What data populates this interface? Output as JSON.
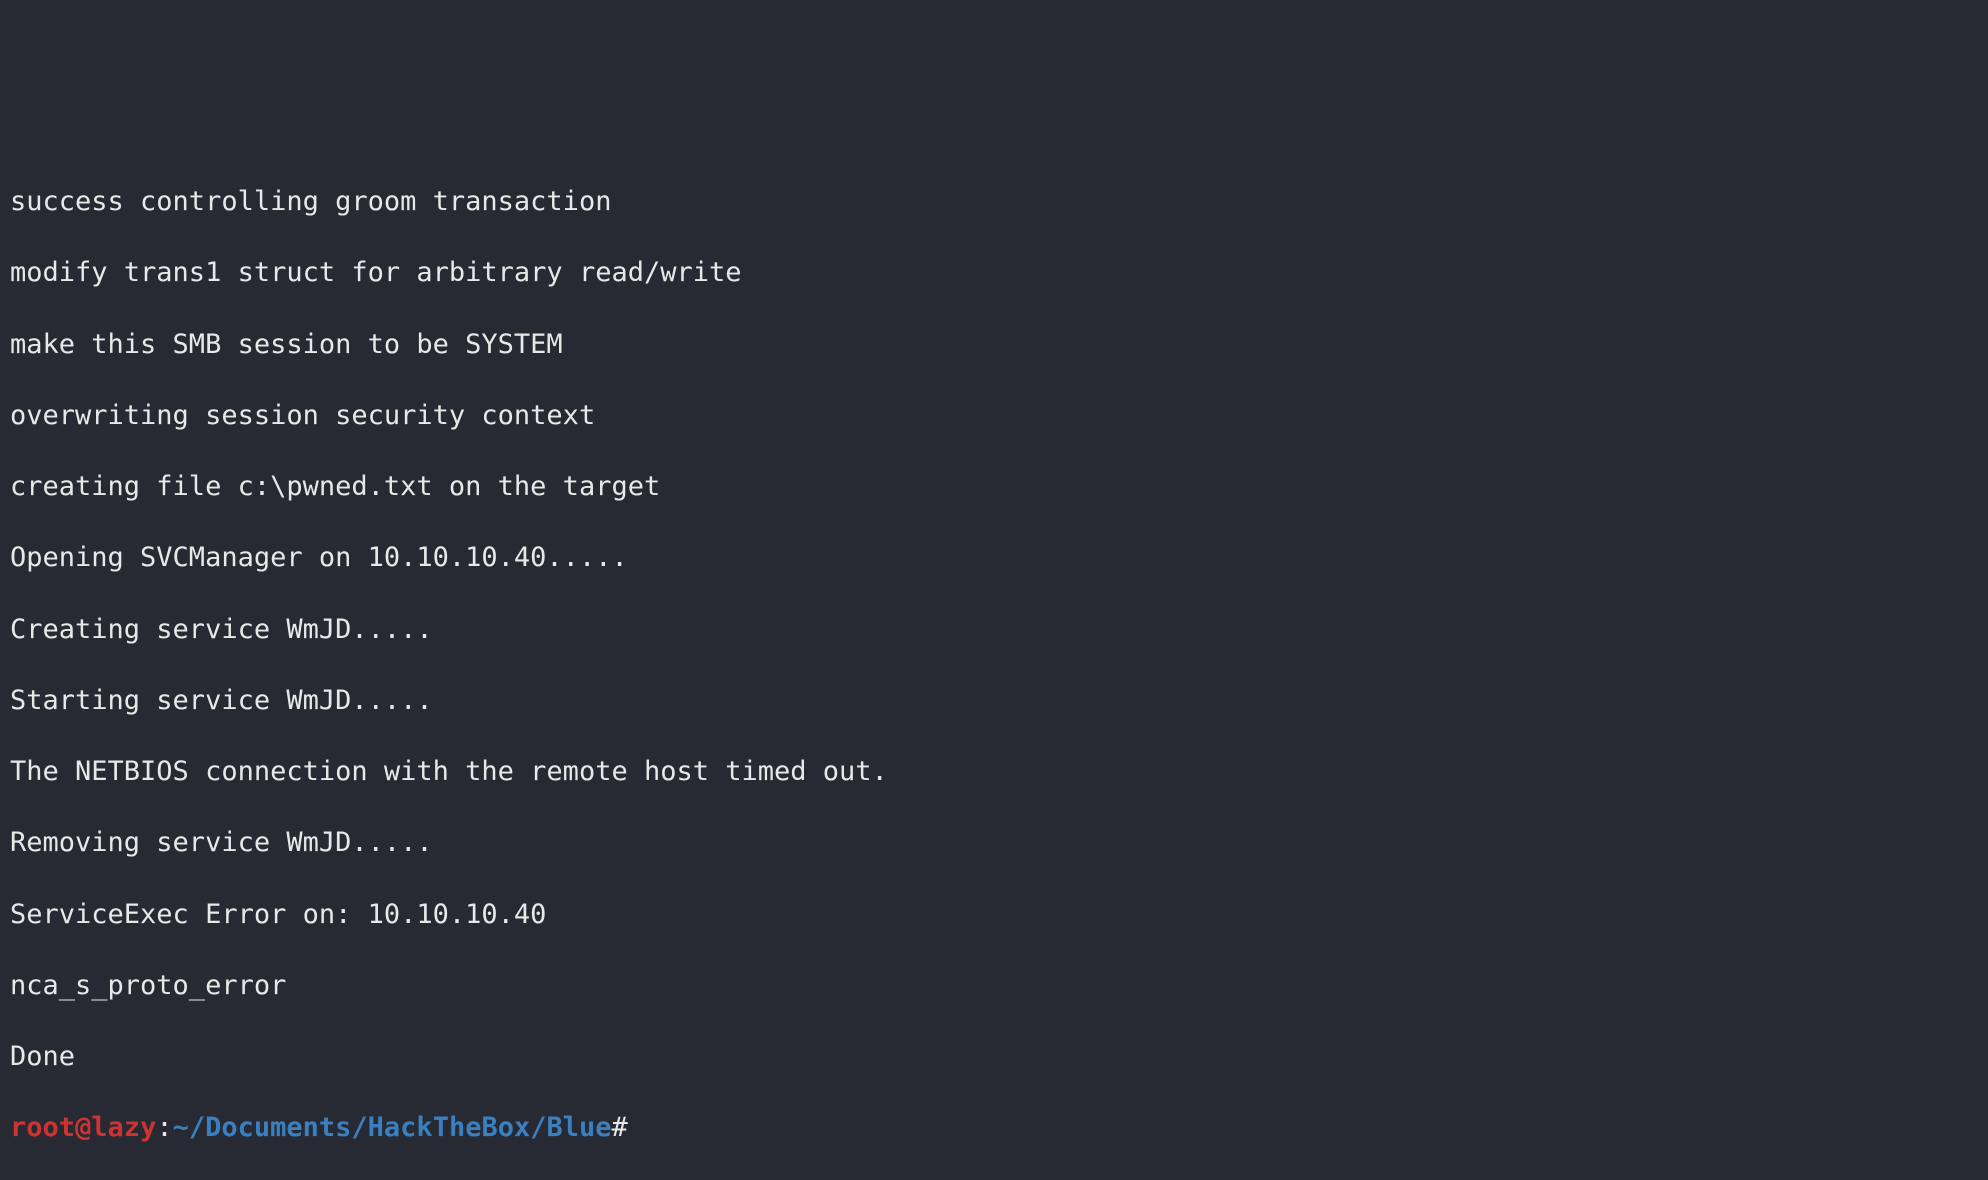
{
  "output": {
    "lines": [
      "success controlling groom transaction",
      "modify trans1 struct for arbitrary read/write",
      "make this SMB session to be SYSTEM",
      "overwriting session security context",
      "creating file c:\\pwned.txt on the target",
      "Opening SVCManager on 10.10.10.40.....",
      "Creating service WmJD.....",
      "Starting service WmJD.....",
      "The NETBIOS connection with the remote host timed out.",
      "Removing service WmJD.....",
      "ServiceExec Error on: 10.10.10.40",
      "nca_s_proto_error",
      "Done"
    ]
  },
  "prompt": {
    "user": "root",
    "at": "@",
    "host": "lazy",
    "colon": ":",
    "tilde": "~",
    "path": "/Documents/HackTheBox/Blue",
    "hash": "#",
    "input": ""
  }
}
